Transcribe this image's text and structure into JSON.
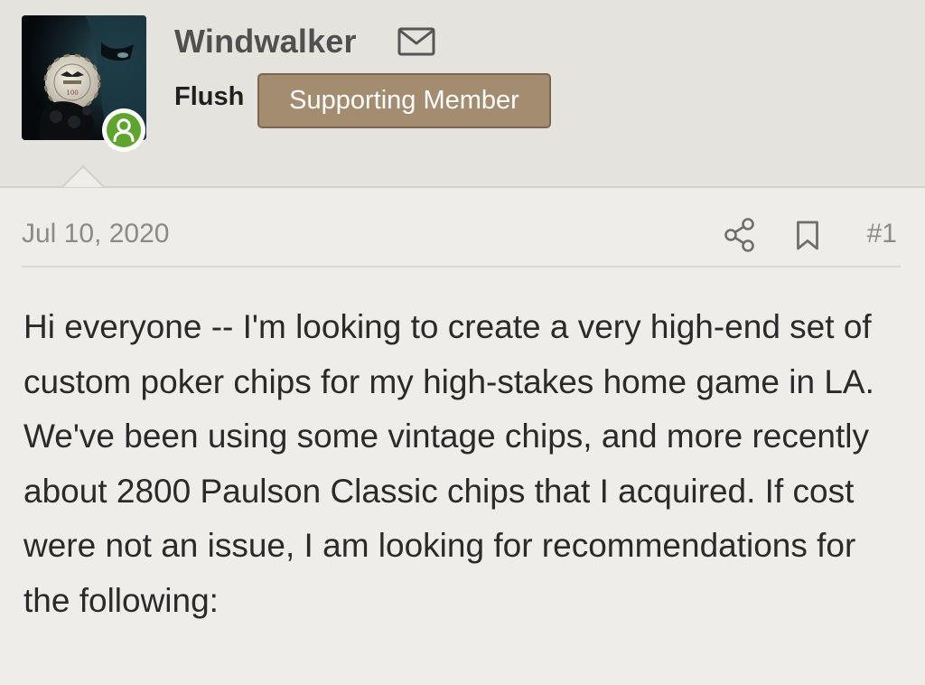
{
  "user": {
    "name": "Windwalker",
    "rank": "Flush",
    "badge": "Supporting Member",
    "online": true,
    "avatar_icon": "avatar-image",
    "contact_icon": "mail-icon"
  },
  "post": {
    "date": "Jul 10, 2020",
    "number": "#1",
    "actions": [
      "share-icon",
      "bookmark-icon"
    ],
    "body": "Hi everyone -- I'm looking to create a very high-end set of custom poker chips for my high-stakes home game in LA. We've been using some vintage chips, and more recently about 2800 Paulson Classic chips that I acquired. If cost were not an issue, I am looking for recommendations for the following:"
  },
  "colors": {
    "badge_bg": "#a38c6f",
    "online_green": "#5fa42f",
    "header_bg": "#e4e3dd",
    "page_bg": "#eeede9"
  }
}
